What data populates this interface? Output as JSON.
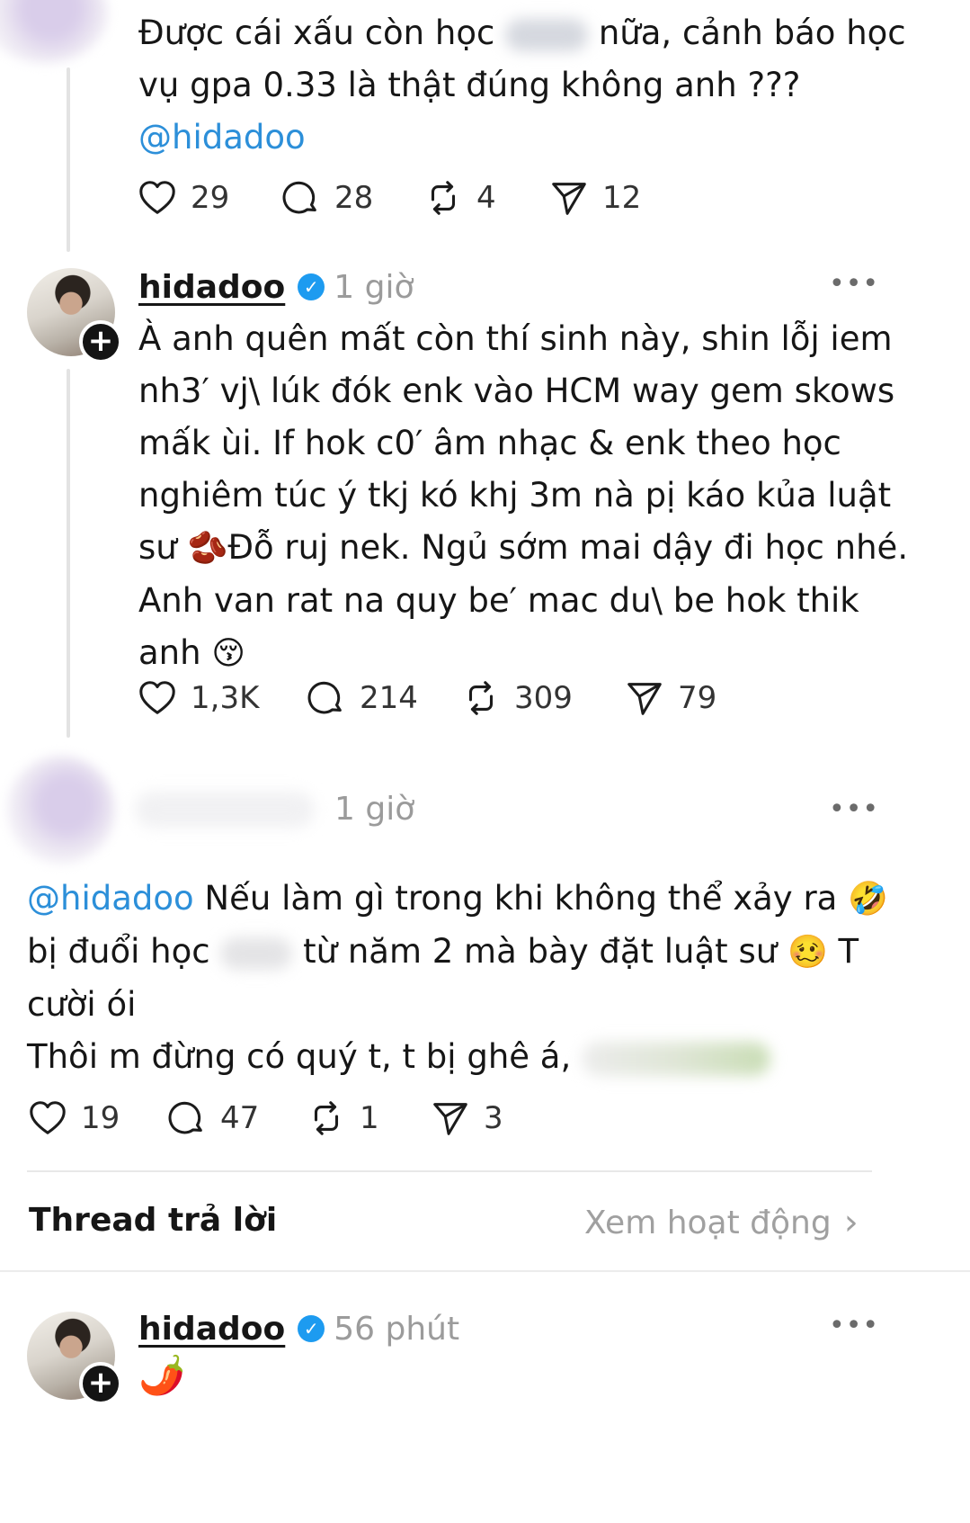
{
  "post1": {
    "line1_a": "Được cái xấu còn học",
    "line1_b": "nữa, cảnh báo học",
    "line2": "vụ gpa 0.33 là thật đúng không anh ???",
    "mention": "@hidadoo",
    "likes": "29",
    "comments": "28",
    "reposts": "4",
    "shares": "12"
  },
  "post2": {
    "username": "hidadoo",
    "verified_mark": "✓",
    "time": "1 giờ",
    "more": "•••",
    "lines": [
      "À anh quên mất còn thí sinh này, shin lỗj iem",
      "nh3′ vj\\ lúk đók enk vào HCM way gem skows",
      "mấk ùi. If hok c0′ âm nhạc & enk theo học",
      "nghiêm túc ý tkj kó khj 3m nà pị káo kủa luật"
    ],
    "line5_a": "sư",
    "beans_emoji": "🫘",
    "line5_b": "Đỗ ruj nek. Ngủ sớm mai dậy đi học nhé.",
    "line6": "Anh van rat na quy be′ mac du\\ be hok thik",
    "line7": "anh",
    "kiss_emoji": "😚",
    "likes": "1,3K",
    "comments": "214",
    "reposts": "309",
    "shares": "79"
  },
  "post3": {
    "time": "1 giờ",
    "more": "•••",
    "mention": "@hidadoo",
    "line1_rest": "Nếu làm gì trong khi không thể xảy ra",
    "rofl_emoji": "🤣",
    "line2_a": "bị đuổi học",
    "line2_b": "từ năm 2 mà bày đặt luật sư",
    "woozy_emoji": "🥴",
    "line2_c": "T",
    "line3": "cười ói",
    "line4": "Thôi m đừng có quý t, t bị ghê á,",
    "likes": "19",
    "comments": "47",
    "reposts": "1",
    "shares": "3"
  },
  "replies_header": {
    "title": "Thread trả lời",
    "activity_link": "Xem hoạt động",
    "chevron": "›"
  },
  "post4": {
    "username": "hidadoo",
    "verified_mark": "✓",
    "time": "56 phút",
    "more": "•••",
    "pepper_emoji": "🌶️"
  },
  "avatar_badge": "+"
}
